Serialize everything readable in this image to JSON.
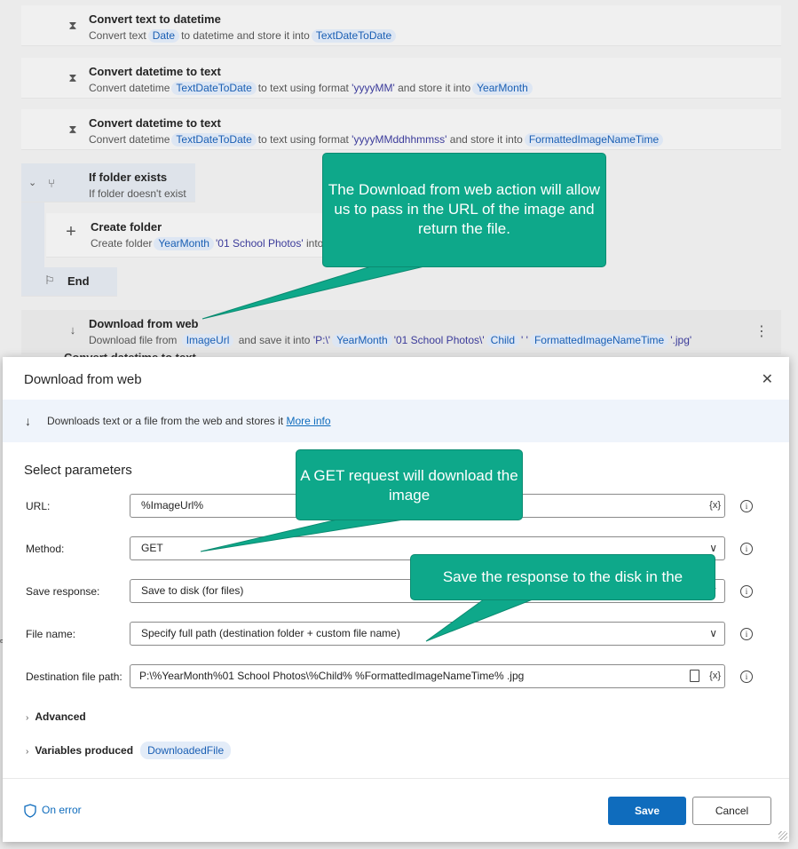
{
  "flow": {
    "steps": [
      {
        "title": "Convert text to datetime",
        "sub_a": "Convert text",
        "tok_a": "Date",
        "sub_b": "to datetime and store it into",
        "tok_b": "TextDateToDate"
      },
      {
        "title": "Convert datetime to text",
        "sub_a": "Convert datetime",
        "tok_a": "TextDateToDate",
        "sub_b": "to text using format",
        "fmt": "'yyyyMM'",
        "sub_c": "and store it into",
        "tok_b": "YearMonth"
      },
      {
        "title": "Convert datetime to text",
        "sub_a": "Convert datetime",
        "tok_a": "TextDateToDate",
        "sub_b": "to text using format",
        "fmt": "'yyyyMMddhhmmss'",
        "sub_c": "and store it into",
        "tok_b": "FormattedImageNameTime"
      }
    ],
    "if_folder": {
      "title": "If folder exists",
      "sub": "If folder  doesn't exist"
    },
    "create_folder": {
      "title": "Create folder",
      "sub_a": "Create folder",
      "tok_a": "YearMonth",
      "str_a": "'01 School Photos'",
      "sub_b": "into"
    },
    "end": {
      "title": "End"
    },
    "download": {
      "title": "Download from web",
      "sub_a": "Download file from",
      "tok_a": "ImageUrl",
      "sub_b": "and save it into",
      "str_a": "'P:\\'",
      "tok_b": "YearMonth",
      "str_b": "'01 School Photos\\'",
      "tok_c": "Child",
      "str_c": "' '",
      "tok_d": "FormattedImageNameTime",
      "str_d": "'.jpg'",
      "kebab": "⋮"
    },
    "peek": "Convert datetime to text"
  },
  "dialog": {
    "title": "Download from web",
    "close": "✕",
    "description": "Downloads text or a file from the web and stores it",
    "more_info": "More info",
    "select_params": "Select parameters",
    "fields": {
      "url": {
        "label": "URL:",
        "value": "%ImageUrl%",
        "var_btn": "{x}"
      },
      "method": {
        "label": "Method:",
        "value": "GET"
      },
      "save_response": {
        "label": "Save response:",
        "value": "Save to disk (for files)"
      },
      "file_name": {
        "label": "File name:",
        "value": "Specify full path (destination folder + custom file name)"
      },
      "destination": {
        "label": "Destination file path:",
        "value": "P:\\%YearMonth%01 School Photos\\%Child% %FormattedImageNameTime% .jpg",
        "var_btn": "{x}"
      }
    },
    "info_glyph": "i",
    "advanced": "Advanced",
    "variables_produced": "Variables produced",
    "downloaded_file": "DownloadedFile",
    "on_error": "On error",
    "save": "Save",
    "cancel": "Cancel"
  },
  "callouts": {
    "c1": "The Download from web action will allow us to pass in the URL of the image and return the file.",
    "c2": "A GET request will download the image",
    "c3": "Save the response to the disk in the"
  },
  "colors": {
    "callout": "#0ea88a",
    "accent": "#0f6cbd",
    "token_bg": "#dde6f3"
  }
}
